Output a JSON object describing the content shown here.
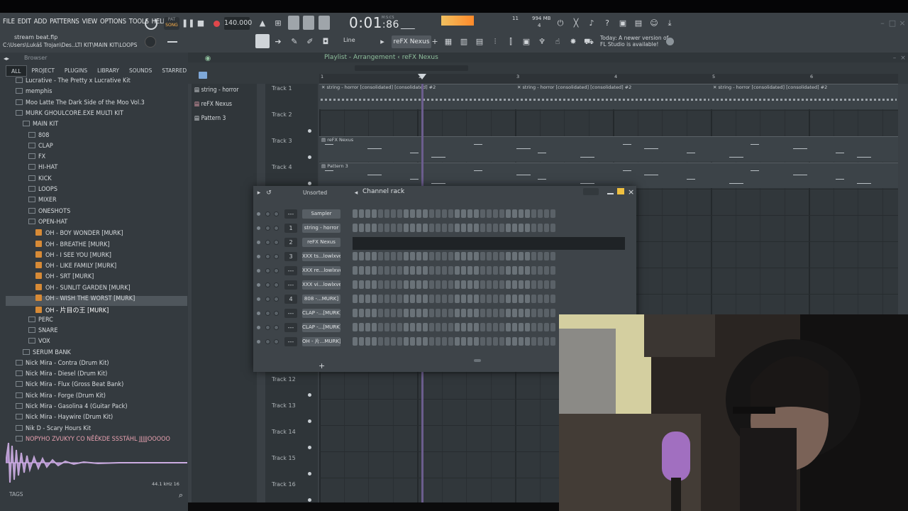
{
  "menus": [
    "FILE",
    "EDIT",
    "ADD",
    "PATTERNS",
    "VIEW",
    "OPTIONS",
    "TOOLS",
    "HELP"
  ],
  "transport": {
    "pat_label": "PAT",
    "song_label": "SONG",
    "bpm": "140.000",
    "time": "0:01",
    "time_small": ":86",
    "time_unit": "M:S:CS",
    "cpu_a": "11",
    "cpu_b": "994 MB",
    "cpu_c": "4"
  },
  "file": {
    "name": "stream beat.flp",
    "path": "C:\\Users\\Lukáš Trojan\\Des..LTI KIT\\MAIN KIT\\LOOPS"
  },
  "toolbar": {
    "snap": "Line",
    "pattern": "reFX Nexus",
    "news": [
      "Today: A newer version of",
      "FL Studio is available!"
    ]
  },
  "browser": {
    "title": "Browser",
    "tabs": [
      "ALL",
      "PROJECT",
      "PLUGINS",
      "LIBRARY",
      "SOUNDS",
      "STARRED"
    ],
    "tree": [
      {
        "label": "Lucrative - The Pretty x Lucrative Kit",
        "level": 1,
        "type": "folder"
      },
      {
        "label": "memphis",
        "level": 1,
        "type": "folder"
      },
      {
        "label": "Moo Latte The Dark Side of the Moo Vol.3",
        "level": 1,
        "type": "folder"
      },
      {
        "label": "MURK GHOULCORE.EXE MULTI KIT",
        "level": 1,
        "type": "folder"
      },
      {
        "label": "MAIN KIT",
        "level": 2,
        "type": "folder"
      },
      {
        "label": "808",
        "level": 3,
        "type": "folder"
      },
      {
        "label": "CLAP",
        "level": 3,
        "type": "folder"
      },
      {
        "label": "FX",
        "level": 3,
        "type": "folder"
      },
      {
        "label": "HI-HAT",
        "level": 3,
        "type": "folder"
      },
      {
        "label": "KICK",
        "level": 3,
        "type": "folder"
      },
      {
        "label": "LOOPS",
        "level": 3,
        "type": "folder"
      },
      {
        "label": "MIXER",
        "level": 3,
        "type": "folder"
      },
      {
        "label": "ONESHOTS",
        "level": 3,
        "type": "folder"
      },
      {
        "label": "OPEN-HAT",
        "level": 3,
        "type": "folder"
      },
      {
        "label": "OH - BOY WONDER [MURK]",
        "level": 4,
        "type": "file"
      },
      {
        "label": "OH - BREATHE [MURK]",
        "level": 4,
        "type": "file"
      },
      {
        "label": "OH - I SEE YOU [MURK]",
        "level": 4,
        "type": "file"
      },
      {
        "label": "OH - LIKE FAMILY [MURK]",
        "level": 4,
        "type": "file"
      },
      {
        "label": "OH - SRT [MURK]",
        "level": 4,
        "type": "file"
      },
      {
        "label": "OH - SUNLIT GARDEN [MURK]",
        "level": 4,
        "type": "file"
      },
      {
        "label": "OH - WISH THE WORST [MURK]",
        "level": 4,
        "type": "file"
      },
      {
        "label": "OH - 片目の王 [MURK]",
        "level": 4,
        "type": "file"
      },
      {
        "label": "PERC",
        "level": 3,
        "type": "folder"
      },
      {
        "label": "SNARE",
        "level": 3,
        "type": "folder"
      },
      {
        "label": "VOX",
        "level": 3,
        "type": "folder"
      },
      {
        "label": "SERUM BANK",
        "level": 2,
        "type": "folder"
      },
      {
        "label": "Nick Mira - Contra (Drum Kit)",
        "level": 1,
        "type": "folder"
      },
      {
        "label": "Nick Mira - Diesel (Drum Kit)",
        "level": 1,
        "type": "folder"
      },
      {
        "label": "Nick Mira - Flux (Gross Beat Bank)",
        "level": 1,
        "type": "folder"
      },
      {
        "label": "Nick Mira - Forge (Drum Kit)",
        "level": 1,
        "type": "folder"
      },
      {
        "label": "Nick Mira - Gasolina 4 (Guitar Pack)",
        "level": 1,
        "type": "folder"
      },
      {
        "label": "Nick Mira - Haywire (Drum Kit)",
        "level": 1,
        "type": "folder"
      },
      {
        "label": "Nik D - Scary Hours Kit",
        "level": 1,
        "type": "folder"
      },
      {
        "label": "NOPYHO ZVUKYY CO NĚĚKDE SSSTÁHL JJJJJOOOOO",
        "level": 1,
        "type": "folder"
      }
    ],
    "selected_index": 21,
    "wave_meta": "44.1 kHz 16",
    "tags": "TAGS"
  },
  "playlist": {
    "title": "Playlist - Arrangement",
    "pattern": "reFX Nexus",
    "patterns": [
      "string - horror",
      "reFX Nexus",
      "Pattern 3"
    ],
    "tracks": [
      "Track 1",
      "Track 2",
      "Track 3",
      "Track 4"
    ],
    "tracks_lower": [
      "Track 12",
      "Track 13",
      "Track 14",
      "Track 15",
      "Track 16"
    ],
    "bars": [
      "1",
      "2",
      "3",
      "4",
      "5",
      "6"
    ],
    "clips": [
      {
        "label": "string - horror [consolidated] [consolidated] #2"
      },
      {
        "label": "string - horror [consolidated] [consolidated] #2"
      },
      {
        "label": "string - horror [consolidated] [consolidated] #2"
      },
      {
        "label": "reFX Nexus"
      },
      {
        "label": "Pattern 3"
      }
    ]
  },
  "channel_rack": {
    "title": "Channel rack",
    "filter": "Unsorted",
    "channels": [
      {
        "num": "---",
        "name": "Sampler"
      },
      {
        "num": "1",
        "name": "string - horror"
      },
      {
        "num": "2",
        "name": "reFX Nexus"
      },
      {
        "num": "3",
        "name": "XXX ts...lowlxve"
      },
      {
        "num": "---",
        "name": "XXX re...lowlxve"
      },
      {
        "num": "---",
        "name": "XXX vi...lowlxve"
      },
      {
        "num": "4",
        "name": "808 -...MURK]"
      },
      {
        "num": "---",
        "name": "CLAP -...[MURK]"
      },
      {
        "num": "---",
        "name": "CLAP -...[MURK]"
      },
      {
        "num": "---",
        "name": "OH - 片...MURK]"
      }
    ],
    "add": "+"
  },
  "colors": {
    "accent": "#ffb24a",
    "green": "#8fbf9d",
    "highlight": "#e8a1b0",
    "step": "#6a7278"
  }
}
